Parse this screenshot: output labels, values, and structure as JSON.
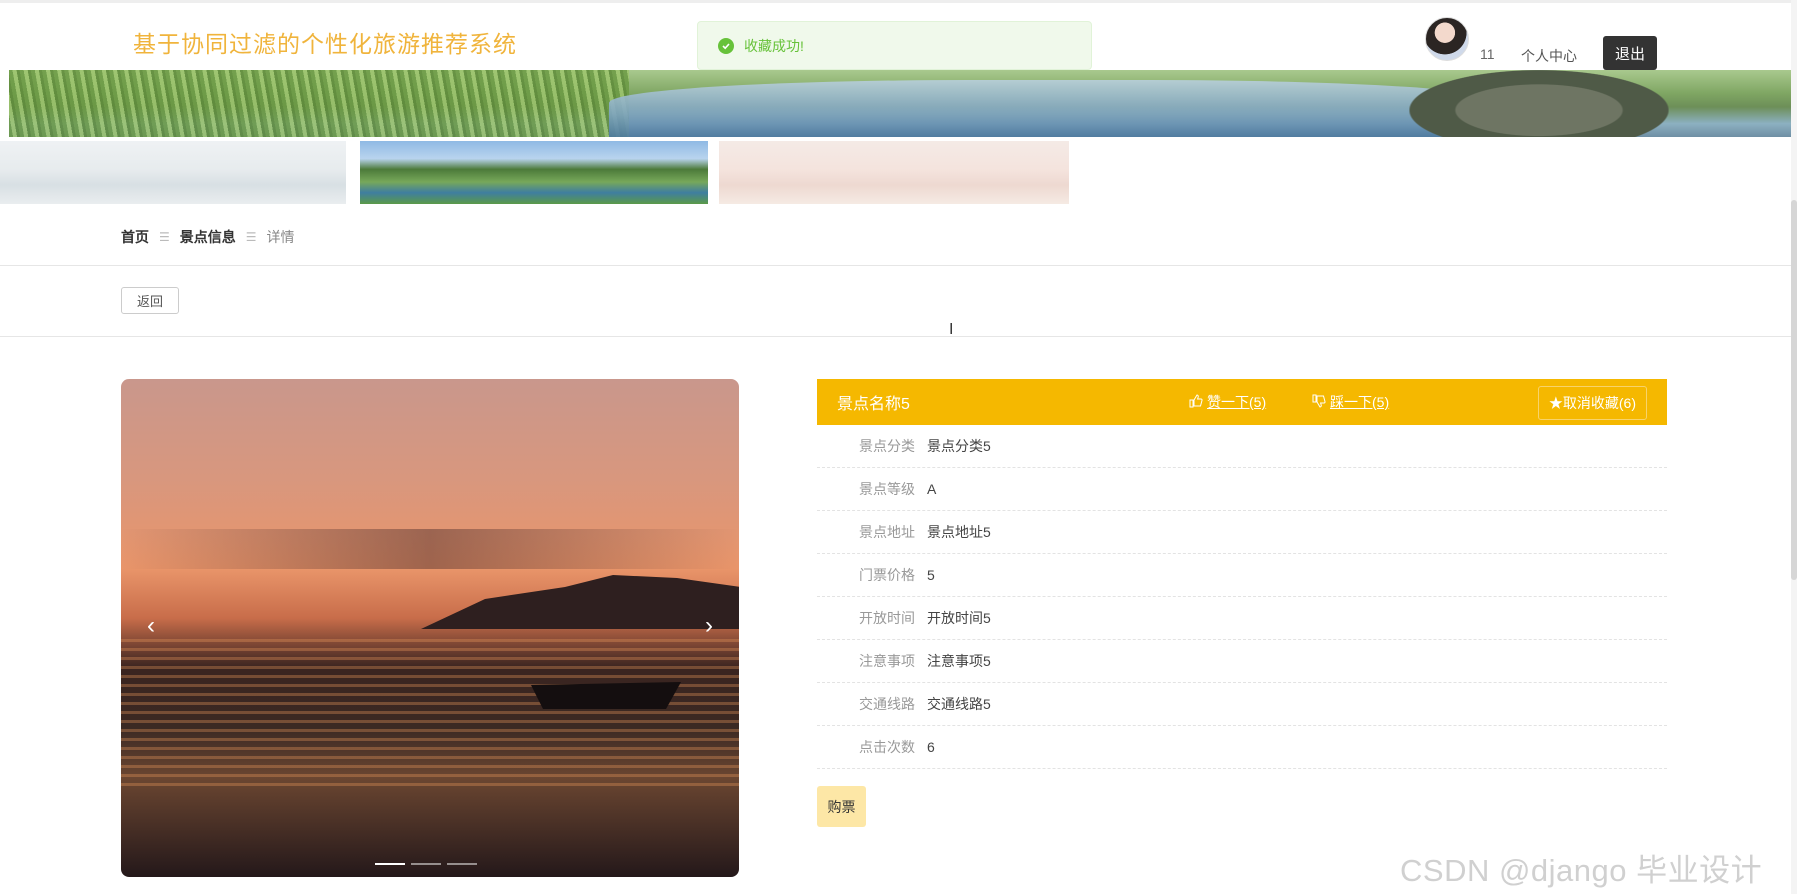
{
  "site_title": "基于协同过滤的个性化旅游推荐系统",
  "toast": {
    "message": "收藏成功!"
  },
  "user": {
    "name": "11",
    "center_label": "个人中心",
    "logout_label": "退出"
  },
  "breadcrumb": [
    "首页",
    "景点信息",
    "详情"
  ],
  "breadcrumb_sep": "☰",
  "back_label": "返回",
  "carousel": {
    "prev": "‹",
    "next": "›",
    "slide_count": 3,
    "active_slide": 1
  },
  "detail": {
    "name": "景点名称5",
    "like_label": "赞一下(5)",
    "dislike_label": "踩一下(5)",
    "fav_label": "取消收藏(6)",
    "fields": [
      {
        "label": "景点分类",
        "value": "景点分类5"
      },
      {
        "label": "景点等级",
        "value": "A"
      },
      {
        "label": "景点地址",
        "value": "景点地址5"
      },
      {
        "label": "门票价格",
        "value": "5"
      },
      {
        "label": "开放时间",
        "value": "开放时间5"
      },
      {
        "label": "注意事项",
        "value": "注意事项5"
      },
      {
        "label": "交通线路",
        "value": "交通线路5"
      },
      {
        "label": "点击次数",
        "value": "6"
      }
    ],
    "buy_label": "购票"
  },
  "watermark": "CSDN @django 毕业设计",
  "colors": {
    "accent": "#f5b800",
    "title": "#f0b43c",
    "toast_success": "#67c23a",
    "buy_button": "#fde7a6"
  }
}
